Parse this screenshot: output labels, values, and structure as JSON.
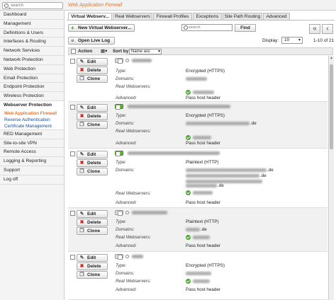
{
  "topbar": {
    "search_placeholder": "search",
    "breadcrumb": "Web Application Firewall"
  },
  "sidebar": {
    "items": [
      "Dashboard",
      "Management",
      "Definitions & Users",
      "Interfaces & Routing",
      "Network Services",
      "Network Protection",
      "Web Protection",
      "Email Protection",
      "Endpoint Protection",
      "Wireless Protection",
      "Webserver Protection"
    ],
    "subitems": [
      "Web Application Firewall",
      "Reverse Authentication",
      "Certificate Management"
    ],
    "items_after": [
      "RED Management",
      "Site-to-site VPN",
      "Remote Access",
      "Logging & Reporting",
      "Support",
      "Log off"
    ]
  },
  "tabs": [
    "Virtual Webserv...",
    "Real Webservers",
    "Firewall Profiles",
    "Exceptions",
    "Site Path Routing",
    "Advanced"
  ],
  "toolbar": {
    "new_button": "New Virtual Webserver...",
    "live_log_button": "Open Live Log",
    "search_placeholder": "search",
    "find_button": "Find",
    "first_page": "«",
    "prev_page": "‹",
    "display_label": "Display:",
    "display_value": "10",
    "range_text": "1-10 of 21"
  },
  "table_head": {
    "action": "Action",
    "sort_label": "Sort by:",
    "sort_value": "Name asc"
  },
  "actions": {
    "edit": "Edit",
    "delete": "Delete",
    "clone": "Clone"
  },
  "labels": {
    "type": "Type:",
    "domains": "Domains:",
    "real_webservers": "Real Webservers:",
    "advanced": "Advanced:"
  },
  "rows": [
    {
      "type": "Encrypted (HTTPS)",
      "domains": "",
      "advanced": "Pass host header",
      "toggle": "off"
    },
    {
      "type": "Encrypted (HTTPS)",
      "domains": ".de",
      "advanced": "Pass host header",
      "toggle": "on"
    },
    {
      "type": "Plaintext (HTTP)",
      "domains": ".de",
      "domains2": ".de",
      "domains3": ".de",
      "advanced": "Pass host header",
      "toggle": "on"
    },
    {
      "type": "Plaintext (HTTP)",
      "domains": ".de",
      "advanced": "Pass host header",
      "toggle": "off"
    },
    {
      "type": "Encrypted (HTTPS)",
      "domains": "",
      "advanced": "Pass host header",
      "toggle": "off"
    }
  ],
  "colors": {
    "accent": "#e8752a",
    "link": "#1a4fa0",
    "status_ok": "#4aa52e"
  }
}
